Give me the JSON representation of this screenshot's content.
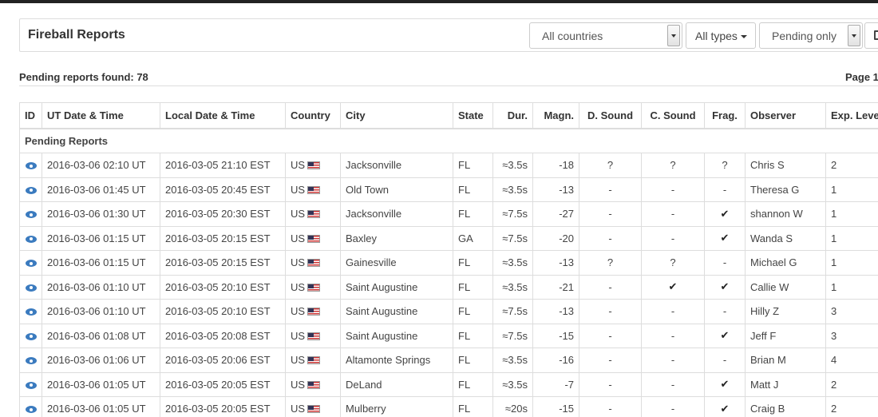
{
  "header": {
    "title": "Fireball Reports",
    "country_filter": "All countries",
    "type_filter": "All types",
    "status_filter": "Pending only"
  },
  "summary": {
    "found": "Pending reports found: 78",
    "page": "Page 1"
  },
  "table": {
    "columns": [
      "ID",
      "UT Date & Time",
      "Local Date & Time",
      "Country",
      "City",
      "State",
      "Dur.",
      "Magn.",
      "D. Sound",
      "C. Sound",
      "Frag.",
      "Observer",
      "Exp. Level"
    ],
    "group_label": "Pending Reports",
    "rows": [
      {
        "ut": "2016-03-06 02:10 UT",
        "local": "2016-03-05 21:10 EST",
        "country": "US",
        "city": "Jacksonville",
        "state": "FL",
        "dur": "≈3.5s",
        "magn": "-18",
        "dsound": "?",
        "csound": "?",
        "frag": "?",
        "observer": "Chris S",
        "exp": "2"
      },
      {
        "ut": "2016-03-06 01:45 UT",
        "local": "2016-03-05 20:45 EST",
        "country": "US",
        "city": "Old Town",
        "state": "FL",
        "dur": "≈3.5s",
        "magn": "-13",
        "dsound": "-",
        "csound": "-",
        "frag": "-",
        "observer": "Theresa G",
        "exp": "1"
      },
      {
        "ut": "2016-03-06 01:30 UT",
        "local": "2016-03-05 20:30 EST",
        "country": "US",
        "city": "Jacksonville",
        "state": "FL",
        "dur": "≈7.5s",
        "magn": "-27",
        "dsound": "-",
        "csound": "-",
        "frag": "✔",
        "observer": "shannon W",
        "exp": "1"
      },
      {
        "ut": "2016-03-06 01:15 UT",
        "local": "2016-03-05 20:15 EST",
        "country": "US",
        "city": "Baxley",
        "state": "GA",
        "dur": "≈7.5s",
        "magn": "-20",
        "dsound": "-",
        "csound": "-",
        "frag": "✔",
        "observer": "Wanda S",
        "exp": "1"
      },
      {
        "ut": "2016-03-06 01:15 UT",
        "local": "2016-03-05 20:15 EST",
        "country": "US",
        "city": "Gainesville",
        "state": "FL",
        "dur": "≈3.5s",
        "magn": "-13",
        "dsound": "?",
        "csound": "?",
        "frag": "-",
        "observer": "Michael G",
        "exp": "1"
      },
      {
        "ut": "2016-03-06 01:10 UT",
        "local": "2016-03-05 20:10 EST",
        "country": "US",
        "city": "Saint Augustine",
        "state": "FL",
        "dur": "≈3.5s",
        "magn": "-21",
        "dsound": "-",
        "csound": "✔",
        "frag": "✔",
        "observer": "Callie W",
        "exp": "1"
      },
      {
        "ut": "2016-03-06 01:10 UT",
        "local": "2016-03-05 20:10 EST",
        "country": "US",
        "city": "Saint Augustine",
        "state": "FL",
        "dur": "≈7.5s",
        "magn": "-13",
        "dsound": "-",
        "csound": "-",
        "frag": "-",
        "observer": "Hilly Z",
        "exp": "3"
      },
      {
        "ut": "2016-03-06 01:08 UT",
        "local": "2016-03-05 20:08 EST",
        "country": "US",
        "city": "Saint Augustine",
        "state": "FL",
        "dur": "≈7.5s",
        "magn": "-15",
        "dsound": "-",
        "csound": "-",
        "frag": "✔",
        "observer": "Jeff F",
        "exp": "3"
      },
      {
        "ut": "2016-03-06 01:06 UT",
        "local": "2016-03-05 20:06 EST",
        "country": "US",
        "city": "Altamonte Springs",
        "state": "FL",
        "dur": "≈3.5s",
        "magn": "-16",
        "dsound": "-",
        "csound": "-",
        "frag": "-",
        "observer": "Brian M",
        "exp": "4"
      },
      {
        "ut": "2016-03-06 01:05 UT",
        "local": "2016-03-05 20:05 EST",
        "country": "US",
        "city": "DeLand",
        "state": "FL",
        "dur": "≈3.5s",
        "magn": "-7",
        "dsound": "-",
        "csound": "-",
        "frag": "✔",
        "observer": "Matt J",
        "exp": "2"
      },
      {
        "ut": "2016-03-06 01:05 UT",
        "local": "2016-03-05 20:05 EST",
        "country": "US",
        "city": "Mulberry",
        "state": "FL",
        "dur": "≈20s",
        "magn": "-15",
        "dsound": "-",
        "csound": "-",
        "frag": "✔",
        "observer": "Craig B",
        "exp": "2"
      }
    ]
  },
  "icons": {
    "view": "eye-icon",
    "flag": "us-flag-icon",
    "check": "check-icon",
    "dropdown": "chevron-down-icon",
    "extra": "calendar-icon"
  }
}
